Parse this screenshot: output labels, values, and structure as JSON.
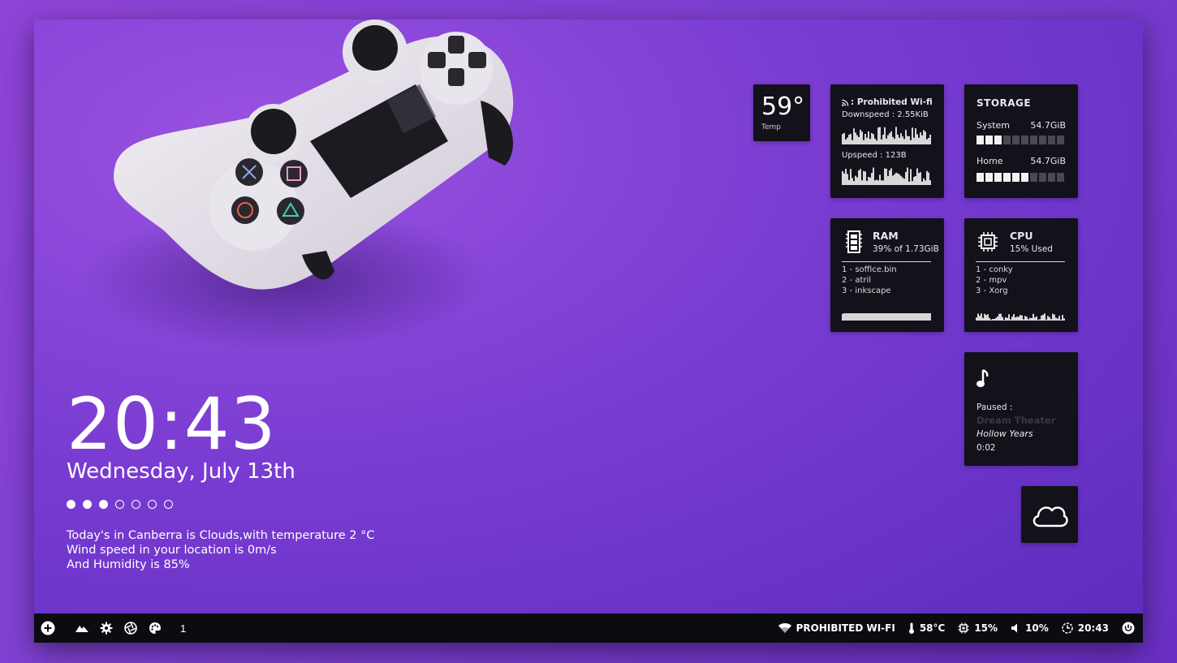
{
  "clock": {
    "time": "20:43",
    "date": "Wednesday, July 13th",
    "dots_filled": 3,
    "dots_total": 7
  },
  "weather_text": {
    "line1": "Today's in Canberra is Clouds,with temperature 2 °C",
    "line2": "Wind speed in your location is 0m/s",
    "line3": "And Humidity is 85%"
  },
  "temp_widget": {
    "value": "59°",
    "label": "Temp"
  },
  "network": {
    "title": ": Prohibited Wi-fi",
    "downspeed": "Downspeed : 2.55KiB",
    "upspeed": "Upspeed : 123B",
    "icon": "wifi-icon"
  },
  "storage": {
    "title": "STORAGE",
    "items": [
      {
        "label": "System",
        "value": "54.7GiB",
        "fill": 3,
        "segments": 10
      },
      {
        "label": "Home",
        "value": "54.7GiB",
        "fill": 6,
        "segments": 10
      }
    ]
  },
  "ram": {
    "title": "RAM",
    "usage": "39% of 1.73GiB",
    "processes": [
      "1 - soffice.bin",
      "2 - atril",
      "3 - inkscape"
    ],
    "icon": "memory-icon"
  },
  "cpu": {
    "title": "CPU",
    "usage": "15% Used",
    "processes": [
      "1 - conky",
      "2 - mpv",
      "3 - Xorg"
    ],
    "icon": "chip-icon"
  },
  "music": {
    "status": "Paused :",
    "artist": "Dream Theater",
    "song": "Hollow Years",
    "time": "0:02",
    "icon": "music-note-icon"
  },
  "cloud_widget": {
    "icon": "cloud-icon"
  },
  "taskbar": {
    "workspace": "1",
    "left_icons": [
      "add-icon",
      "mountain-icon",
      "gear-icon",
      "aperture-icon",
      "palette-icon"
    ],
    "wifi": "PROHIBITED WI-FI",
    "temp": "58°C",
    "cpu": "15%",
    "volume": "10%",
    "clock": "20:43"
  },
  "colors": {
    "background": "#7c3fd0",
    "card": "#131119",
    "taskbar": "#0c0b10"
  }
}
